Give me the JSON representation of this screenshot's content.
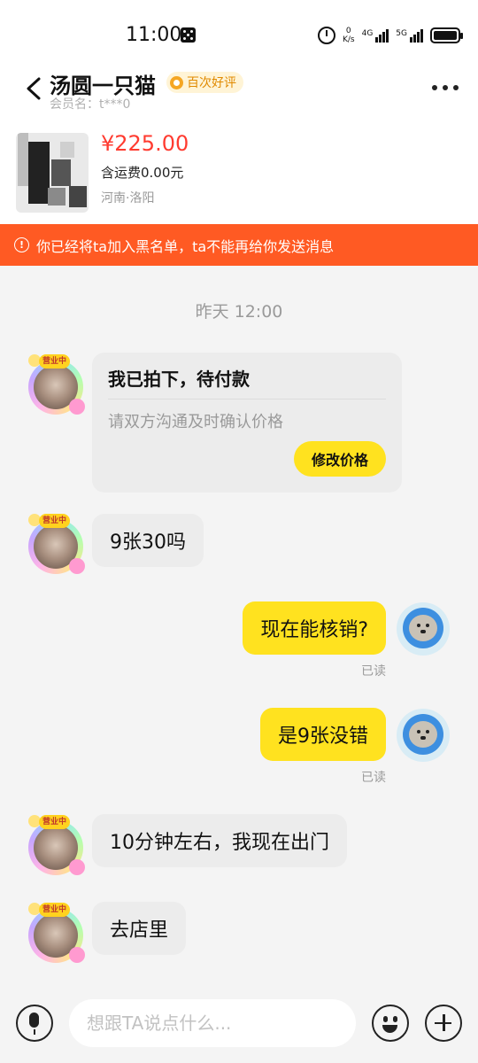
{
  "status_bar": {
    "time": "11:00",
    "net_speed_value": "0",
    "net_speed_unit": "K/s",
    "net1_label": "4G",
    "net2_label": "5G"
  },
  "header": {
    "title": "汤圆一只猫",
    "badge": "百次好评",
    "member": "会员名：t***0"
  },
  "product": {
    "price": "¥225.00",
    "shipping": "含运费0.00元",
    "location": "河南·洛阳"
  },
  "warning": {
    "text": "你已经将ta加入黑名单，ta不能再给你发送消息"
  },
  "chat": {
    "timestamp": "昨天 12:00",
    "order_card": {
      "title": "我已拍下，待付款",
      "subtitle": "请双方沟通及时确认价格",
      "button": "修改价格"
    },
    "avatar_tag": "营业中",
    "messages": [
      {
        "from": "other",
        "text": "9张30吗"
      },
      {
        "from": "self",
        "text": "现在能核销?",
        "status": "已读"
      },
      {
        "from": "self",
        "text": "是9张没错",
        "status": "已读"
      },
      {
        "from": "other",
        "text": "10分钟左右，我现在出门"
      },
      {
        "from": "other",
        "text": "去店里"
      }
    ]
  },
  "input": {
    "placeholder": "想跟TA说点什么..."
  },
  "colors": {
    "accent_yellow": "#ffe21f",
    "price_red": "#ff3b30",
    "warning_orange": "#ff5a23",
    "badge_orange": "#e08a00"
  },
  "icons": [
    "back-arrow-icon",
    "more-icon",
    "alarm-icon",
    "battery-icon",
    "warning-icon",
    "microphone-icon",
    "emoji-icon",
    "plus-icon"
  ]
}
